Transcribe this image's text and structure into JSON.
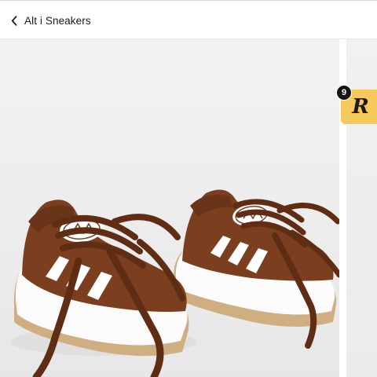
{
  "header": {
    "back_label": "Alt i Sneakers",
    "back_icon": "chevron-left-icon"
  },
  "gallery": {
    "badge_letter": "R",
    "badge_count": "9",
    "badge_color": "#f7c85b",
    "product_color": "#7a3d1e"
  }
}
